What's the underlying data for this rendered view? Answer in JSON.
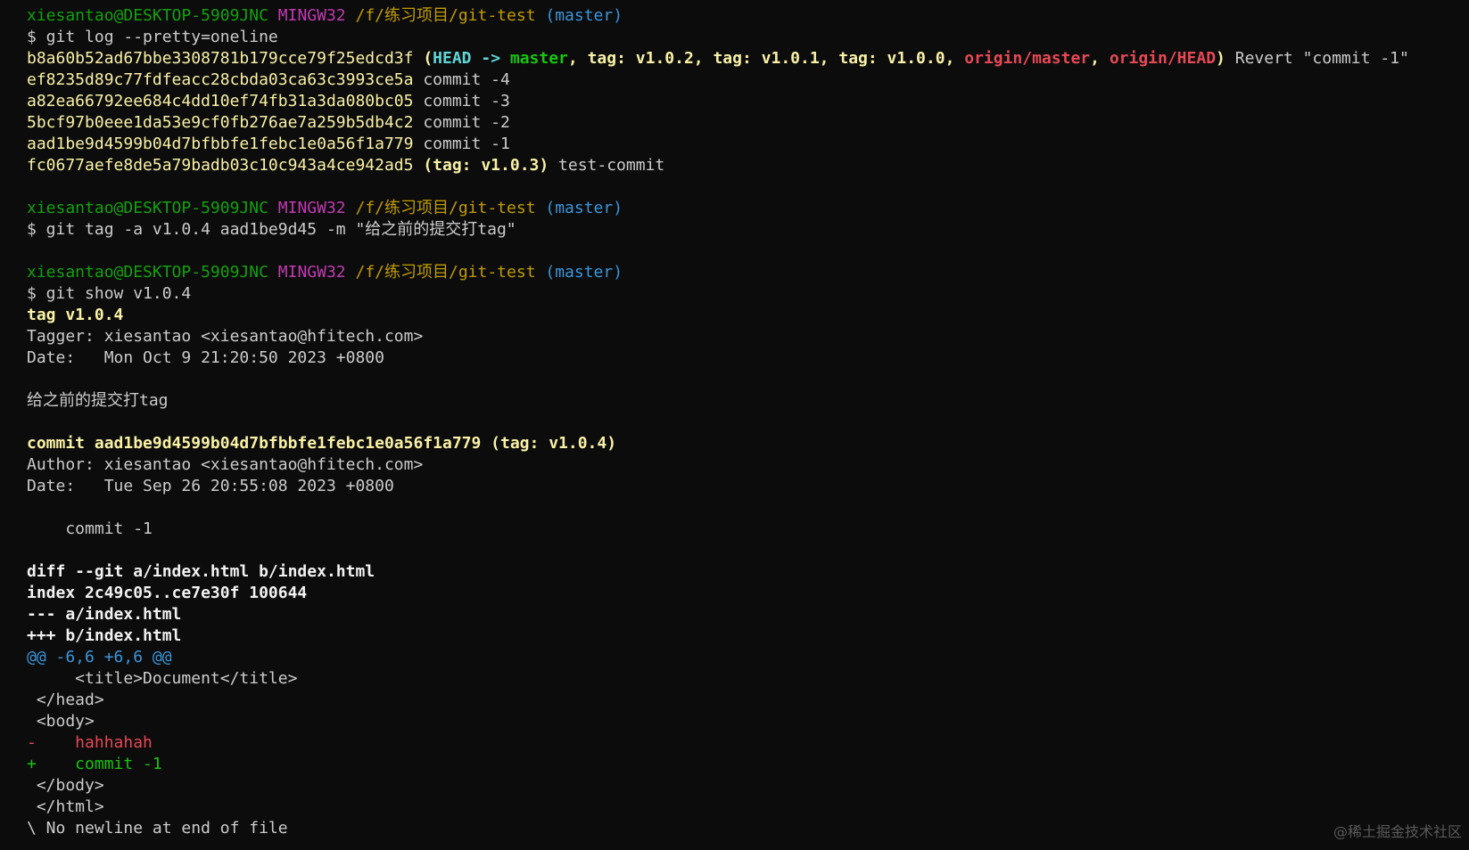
{
  "prompt": {
    "user_host": "xiesantao@DESKTOP-5909JNC",
    "env": "MINGW32",
    "path": "/f/练习项目/git-test",
    "branch": "(master)"
  },
  "commands": {
    "log": "$ git log --pretty=oneline",
    "tag": "$ git tag -a v1.0.4 aad1be9d45 -m \"给之前的提交打tag\"",
    "show": "$ git show v1.0.4"
  },
  "log": {
    "first": {
      "hash": "b8a60b52ad67bbe3308781b179cce79f25edcd3f",
      "open": " (",
      "head": "HEAD ->",
      "sp": " ",
      "master": "master",
      "comma1": ", ",
      "tags": "tag: v1.0.2, tag: v1.0.1, tag: v1.0.0",
      "comma2": ", ",
      "origin_master": "origin/master",
      "comma3": ", ",
      "origin_head": "origin/HEAD",
      "close": ")",
      "message": " Revert \"commit -1\""
    },
    "lines": [
      {
        "hash": "ef8235d89c77fdfeacc28cbda03ca63c3993ce5a",
        "message": " commit -4"
      },
      {
        "hash": "a82ea66792ee684c4dd10ef74fb31a3da080bc05",
        "message": " commit -3"
      },
      {
        "hash": "5bcf97b0eee1da53e9cf0fb276ae7a259b5db4c2",
        "message": " commit -2"
      },
      {
        "hash": "aad1be9d4599b04d7bfbbfe1febc1e0a56f1a779",
        "message": " commit -1"
      }
    ],
    "last": {
      "hash": "fc0677aefe8de5a79badb03c10c943a4ce942ad5",
      "deco": " (tag: v1.0.3)",
      "message": " test-commit"
    }
  },
  "show": {
    "tag_line": "tag v1.0.4",
    "tagger": "Tagger: xiesantao <xiesantao@hfitech.com>",
    "tag_date": "Date:   Mon Oct 9 21:20:50 2023 +0800",
    "tag_message": "给之前的提交打tag",
    "commit_line": "commit aad1be9d4599b04d7bfbbfe1febc1e0a56f1a779 (tag: v1.0.4)",
    "author": "Author: xiesantao <xiesantao@hfitech.com>",
    "commit_date": "Date:   Tue Sep 26 20:55:08 2023 +0800",
    "commit_message": "    commit -1",
    "diff_header": [
      "diff --git a/index.html b/index.html",
      "index 2c49c05..ce7e30f 100644",
      "--- a/index.html",
      "+++ b/index.html"
    ],
    "hunk": "@@ -6,6 +6,6 @@",
    "context_before": [
      "     <title>Document</title>",
      " </head>",
      " <body>"
    ],
    "removed": "-    hahhahah",
    "added": "+    commit -1",
    "context_after": [
      " </body>",
      " </html>"
    ],
    "no_newline": "\\ No newline at end of file"
  },
  "watermark": "@稀土掘金技术社区",
  "colors": {
    "background": "#0c0c0c",
    "user": "#13a10e",
    "mingw": "#c239b3",
    "path": "#c19c00",
    "branch": "#3a96dd",
    "hash_yellow": "#f9f1a5",
    "head_cyan": "#61d6d6",
    "red": "#e74856",
    "green": "#16c60c"
  }
}
